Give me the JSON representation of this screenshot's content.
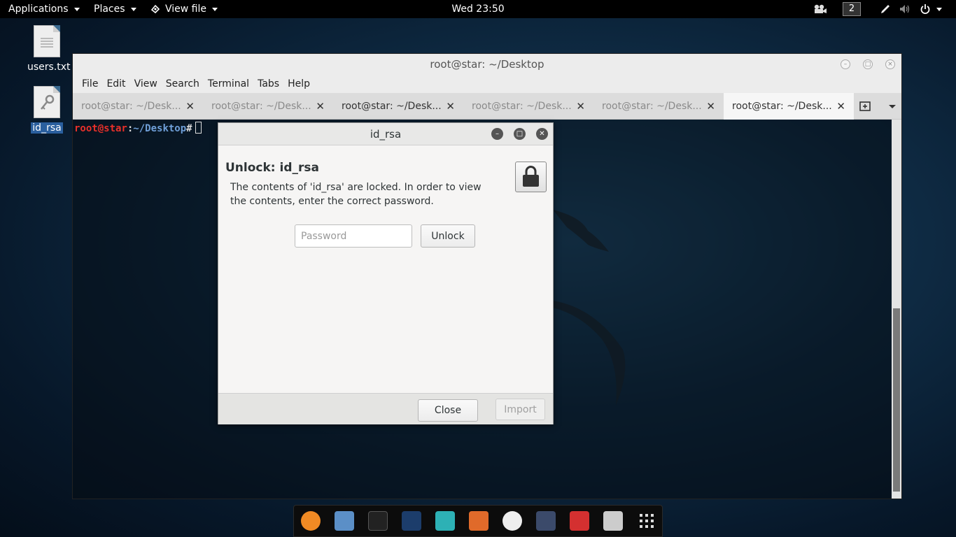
{
  "topbar": {
    "applications": "Applications",
    "places": "Places",
    "view_file": "View file",
    "clock": "Wed 23:50",
    "workspace": "2"
  },
  "desktop": {
    "icons": [
      {
        "label": "users.txt"
      },
      {
        "label": "id_rsa"
      }
    ]
  },
  "terminal": {
    "title": "root@star: ~/Desktop",
    "menu": [
      "File",
      "Edit",
      "View",
      "Search",
      "Terminal",
      "Tabs",
      "Help"
    ],
    "tabs": [
      {
        "label": "root@star: ~/Desk..."
      },
      {
        "label": "root@star: ~/Desk..."
      },
      {
        "label": "root@star: ~/Desk..."
      },
      {
        "label": "root@star: ~/Desk..."
      },
      {
        "label": "root@star: ~/Desk..."
      },
      {
        "label": "root@star: ~/Desk..."
      }
    ],
    "prompt": {
      "user": "root@star",
      "colon": ":",
      "path": "~/Desktop",
      "hash": "#"
    }
  },
  "dialog": {
    "title": "id_rsa",
    "heading": "Unlock: id_rsa",
    "message": "The contents of 'id_rsa' are locked. In order to view the contents, enter the correct password.",
    "password_placeholder": "Password",
    "unlock_label": "Unlock",
    "close_label": "Close",
    "import_label": "Import"
  },
  "dock": {
    "items": [
      "firefox-icon",
      "files-icon",
      "terminal-icon",
      "metasploit-icon",
      "armitage-icon",
      "burpsuite-icon",
      "maltego-icon",
      "beef-icon",
      "faraday-icon",
      "settings-icon",
      "app-grid-icon"
    ]
  }
}
